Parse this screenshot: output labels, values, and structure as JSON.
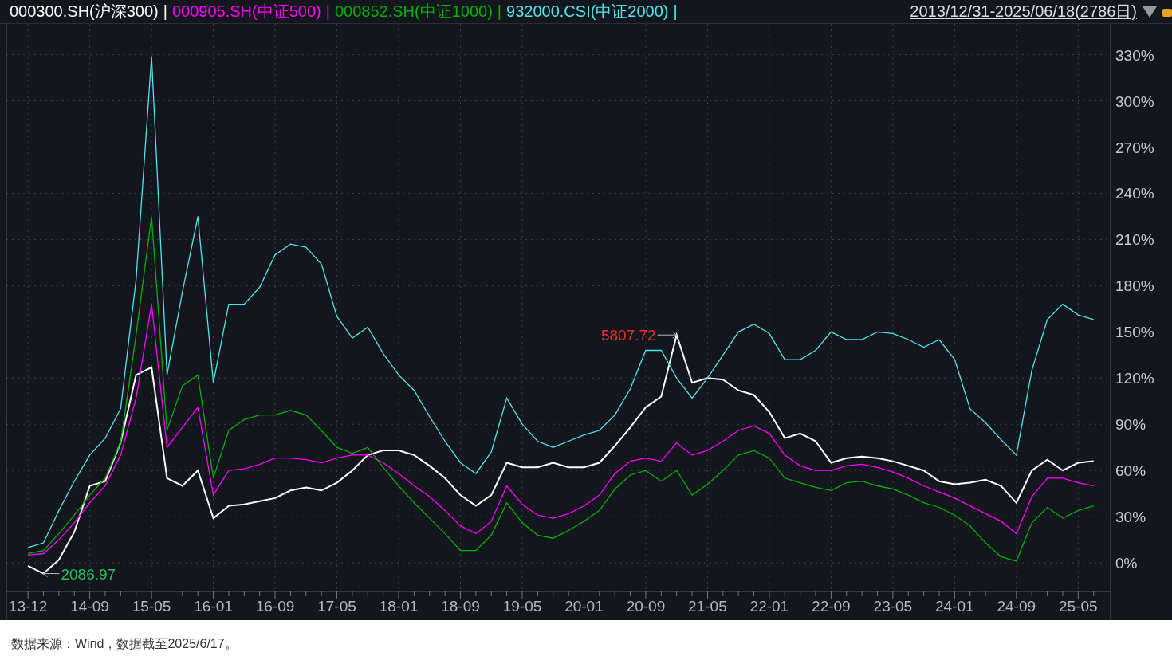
{
  "legend": {
    "separator": "|"
  },
  "date_range": "2013/12/31-2025/06/18(2786日)",
  "chart_data": {
    "type": "line",
    "categories": [
      "13-12",
      null,
      null,
      null,
      "14-09",
      null,
      null,
      null,
      "15-05",
      null,
      null,
      null,
      "16-01",
      null,
      null,
      null,
      "16-09",
      null,
      null,
      null,
      "17-05",
      null,
      null,
      null,
      "18-01",
      null,
      null,
      null,
      "18-09",
      null,
      null,
      null,
      "19-05",
      null,
      null,
      null,
      "20-01",
      null,
      null,
      null,
      "20-09",
      null,
      null,
      null,
      "21-05",
      null,
      null,
      null,
      "22-01",
      null,
      null,
      null,
      "22-09",
      null,
      null,
      null,
      "23-05",
      null,
      null,
      null,
      "24-01",
      null,
      null,
      null,
      "24-09",
      null,
      null,
      null,
      "25-05",
      null
    ],
    "series": [
      {
        "name": "000300.SH(沪深300)",
        "color": "#ffffff",
        "values": [
          -2,
          -7,
          2,
          20,
          50,
          53,
          78,
          122,
          127,
          55,
          50,
          60,
          29,
          37,
          38,
          40,
          42,
          47,
          49,
          47,
          52,
          60,
          70,
          73,
          73,
          70,
          63,
          55,
          44,
          37,
          44,
          65,
          62,
          62,
          65,
          62,
          62,
          65,
          76,
          88,
          101,
          108,
          148,
          117,
          120,
          119,
          112,
          109,
          98,
          81,
          84,
          79,
          65,
          68,
          69,
          68,
          66,
          63,
          60,
          53,
          51,
          52,
          54,
          50,
          39,
          60,
          67,
          60,
          65,
          66
        ]
      },
      {
        "name": "000905.SH(中证500)",
        "color": "#ff00ff",
        "values": [
          5,
          6,
          15,
          26,
          39,
          50,
          70,
          107,
          168,
          75,
          88,
          101,
          44,
          60,
          61,
          64,
          68,
          68,
          67,
          65,
          68,
          70,
          70,
          65,
          58,
          50,
          43,
          34,
          24,
          19,
          27,
          50,
          38,
          31,
          29,
          32,
          37,
          44,
          58,
          66,
          68,
          66,
          78,
          70,
          73,
          79,
          86,
          89,
          84,
          70,
          63,
          60,
          60,
          63,
          64,
          62,
          59,
          55,
          50,
          46,
          42,
          37,
          32,
          27,
          19,
          43,
          55,
          55,
          52,
          50
        ]
      },
      {
        "name": "000852.SH(中证1000)",
        "color": "#00b000",
        "values": [
          6,
          8,
          19,
          31,
          44,
          55,
          78,
          148,
          225,
          86,
          115,
          122,
          55,
          86,
          93,
          96,
          96,
          99,
          96,
          86,
          75,
          71,
          75,
          62,
          50,
          39,
          29,
          19,
          8,
          8,
          18,
          39,
          26,
          18,
          16,
          21,
          27,
          34,
          48,
          57,
          60,
          53,
          60,
          44,
          51,
          60,
          70,
          73,
          68,
          55,
          52,
          49,
          47,
          52,
          53,
          50,
          48,
          44,
          39,
          36,
          31,
          24,
          13,
          4,
          1,
          26,
          36,
          29,
          34,
          37
        ]
      },
      {
        "name": "932000.CSI(中证2000)",
        "color": "#4ee6ee",
        "values": [
          10,
          13,
          34,
          53,
          70,
          81,
          100,
          184,
          329,
          122,
          176,
          225,
          117,
          168,
          168,
          179,
          200,
          207,
          205,
          194,
          160,
          146,
          153,
          136,
          122,
          112,
          95,
          79,
          65,
          58,
          72,
          107,
          90,
          79,
          75,
          79,
          83,
          86,
          96,
          113,
          138,
          138,
          120,
          107,
          120,
          135,
          150,
          155,
          149,
          132,
          132,
          138,
          150,
          145,
          145,
          150,
          149,
          145,
          140,
          145,
          132,
          100,
          91,
          80,
          70,
          125,
          158,
          168,
          161,
          158
        ]
      }
    ],
    "ylim": [
      -18.6,
      350
    ],
    "grid": true,
    "yticks": [
      {
        "value": 0,
        "label": "0%"
      },
      {
        "value": 30,
        "label": "30%"
      },
      {
        "value": 60,
        "label": "60%"
      },
      {
        "value": 90,
        "label": "90%"
      },
      {
        "value": 120,
        "label": "120%"
      },
      {
        "value": 150,
        "label": "150%"
      },
      {
        "value": 180,
        "label": "180%"
      },
      {
        "value": 210,
        "label": "210%"
      },
      {
        "value": 240,
        "label": "240%"
      },
      {
        "value": 270,
        "label": "270%"
      },
      {
        "value": 300,
        "label": "300%"
      },
      {
        "value": 330,
        "label": "330%"
      }
    ],
    "annotations": [
      "5807.72",
      "2086.97"
    ]
  },
  "footer": "数据来源：Wind，数据截至2025/6/17。"
}
